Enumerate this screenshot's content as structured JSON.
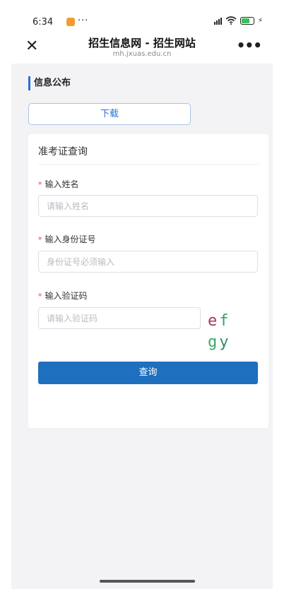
{
  "status_bar": {
    "time": "6:34",
    "dots": "···",
    "charging": "⚡"
  },
  "title_bar": {
    "close_glyph": "✕",
    "title": "招生信息网 - 招生网站",
    "url": "mh.jxuas.edu.cn",
    "more_glyph": "•••"
  },
  "section": {
    "title": "信息公布"
  },
  "download_button": {
    "label": "下载"
  },
  "form": {
    "title": "准考证查询",
    "required_mark": "*",
    "fields": [
      {
        "label": "输入姓名",
        "placeholder": "请输入姓名",
        "value": ""
      },
      {
        "label": "输入身份证号",
        "placeholder": "身份证号必须输入",
        "value": ""
      },
      {
        "label": "输入验证码",
        "placeholder": "请输入验证码",
        "value": ""
      }
    ],
    "captcha": {
      "c1": "e",
      "c2": "f",
      "c3": "g",
      "c4": "y"
    },
    "submit_label": "查询"
  },
  "colors": {
    "accent": "#1f6fbf",
    "link": "#2a6fd1",
    "required": "#e64545",
    "background": "#f3f3f5"
  },
  "icons": [
    "close-icon",
    "more-icon",
    "signal-icon",
    "wifi-icon",
    "battery-icon"
  ]
}
